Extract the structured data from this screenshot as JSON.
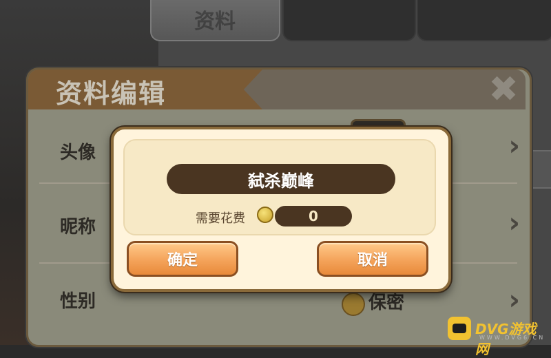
{
  "tabs": [
    {
      "label": "资料",
      "active": true
    },
    {
      "label": "",
      "active": false
    },
    {
      "label": "",
      "active": false
    }
  ],
  "panel": {
    "title": "资料编辑",
    "close_icon": "close-x-icon",
    "rows": [
      {
        "label": "头像",
        "value": ""
      },
      {
        "label": "昵称",
        "value": ""
      },
      {
        "label": "性别",
        "value": "保密"
      }
    ]
  },
  "dialog": {
    "name_value": "弑杀巅峰",
    "cost_label": "需要花费",
    "cost_value": "0",
    "coin_icon": "gold-coin-icon",
    "confirm_label": "确定",
    "cancel_label": "取消"
  },
  "watermark": {
    "brand": "DVG游戏网",
    "domain": "WWW.DVG6.CN"
  },
  "colors": {
    "dialog_bg": "#fff4dc",
    "pill_dark": "#4a3521",
    "button_orange": "#f4a35a",
    "ribbon_brown": "#7a5a35"
  }
}
